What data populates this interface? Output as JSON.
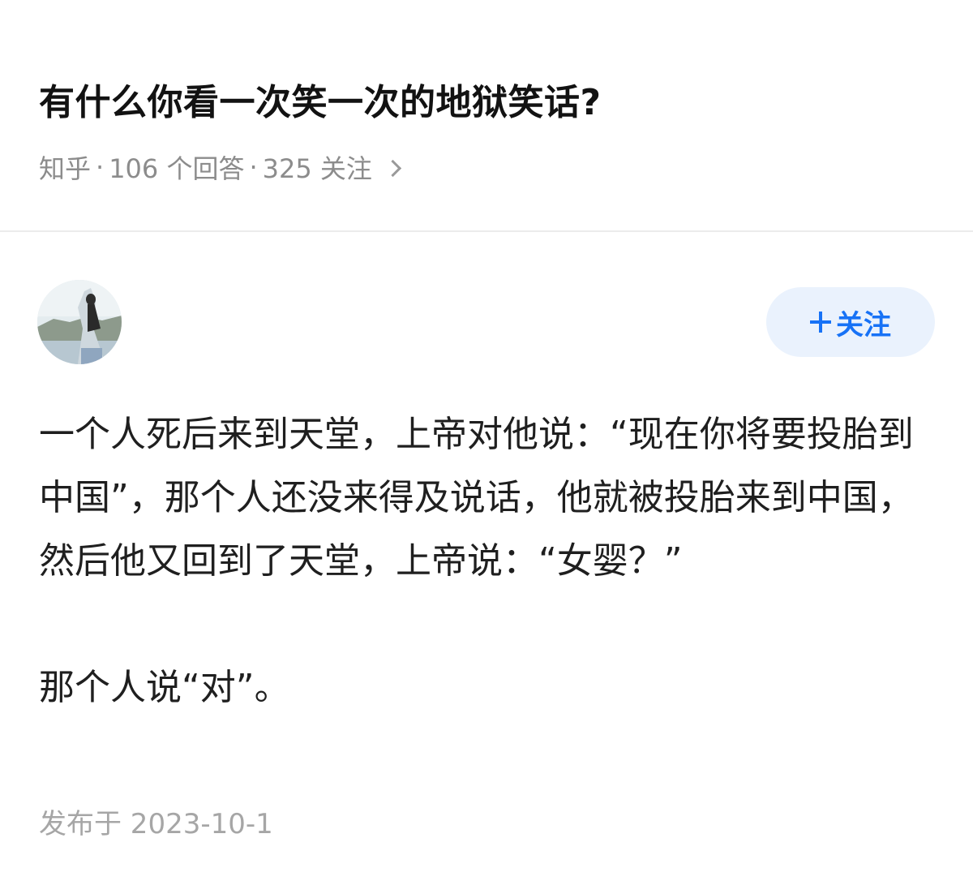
{
  "question": {
    "title": "有什么你看一次笑一次的地狱笑话?",
    "source": "知乎",
    "separator": "·",
    "answers": "106 个回答",
    "followers": "325 关注"
  },
  "author": {
    "name": "",
    "follow_label": "关注"
  },
  "answer": {
    "paragraphs": [
      "一个人死后来到天堂，上帝对他说：“现在你将要投胎到中国”，那个人还没来得及说话，他就被投胎来到中国，然后他又回到了天堂，上帝说：“女婴？”",
      "那个人说“对”。"
    ],
    "published": "发布于 2023-10-1"
  },
  "colors": {
    "accent": "#1772f6",
    "follow_bg": "#eaf2fd",
    "meta_text": "#8c8c8c",
    "divider": "#ececec"
  }
}
